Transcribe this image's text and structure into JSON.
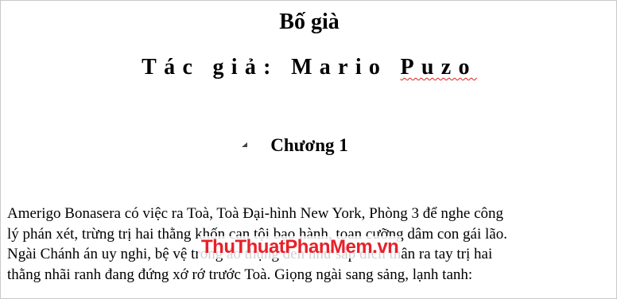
{
  "document": {
    "title": "Bố già",
    "author_label": "Tác giả: Mario ",
    "author_surname": "Puzo",
    "chapter_heading": "Chương 1",
    "paragraph_lines": [
      "Amerigo Bonasera có việc ra Toà, Toà Đại-hình New York, Phòng 3 để nghe công",
      "lý phán xét, trừng trị hai thằng khốn can tội bạo hành, toan cưỡng dâm con gái lão.",
      "Ngài Chánh án uy nghi, bệ vệ trong áo thụng đen như sắp đích thân ra tay trị hai",
      "thằng nhãi ranh đang đứng xớ rớ trước Toà. Giọng ngài sang sảng, lạnh tanh:"
    ]
  },
  "watermark": {
    "text": "ThuThuatPhanMem.vn",
    "color": "#e8202a"
  },
  "icons": {
    "chapter_marker": "collapse-triangle-icon"
  },
  "colors": {
    "spellcheck_underline": "#e02020"
  }
}
